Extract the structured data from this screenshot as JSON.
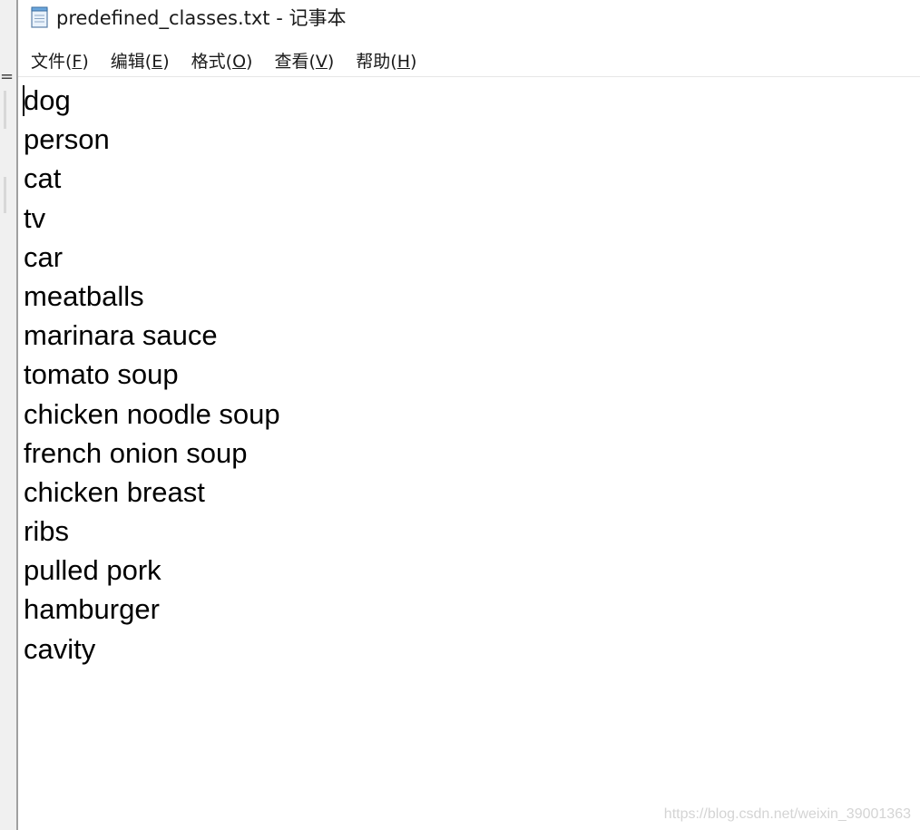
{
  "window": {
    "title": "predefined_classes.txt - 记事本",
    "icon": "notepad-icon"
  },
  "behind": {
    "fragment": "= ("
  },
  "menu": [
    {
      "label": "文件(",
      "accel": "F",
      "tail": ")"
    },
    {
      "label": "编辑(",
      "accel": "E",
      "tail": ")"
    },
    {
      "label": "格式(",
      "accel": "O",
      "tail": ")"
    },
    {
      "label": "查看(",
      "accel": "V",
      "tail": ")"
    },
    {
      "label": "帮助(",
      "accel": "H",
      "tail": ")"
    }
  ],
  "content": {
    "lines": [
      "dog",
      "person",
      "cat",
      "tv",
      "car",
      "meatballs",
      "marinara sauce",
      "tomato soup",
      "chicken noodle soup",
      "french onion soup",
      "chicken breast",
      "ribs",
      "pulled pork",
      "hamburger",
      "cavity"
    ]
  },
  "watermark": "https://blog.csdn.net/weixin_39001363"
}
